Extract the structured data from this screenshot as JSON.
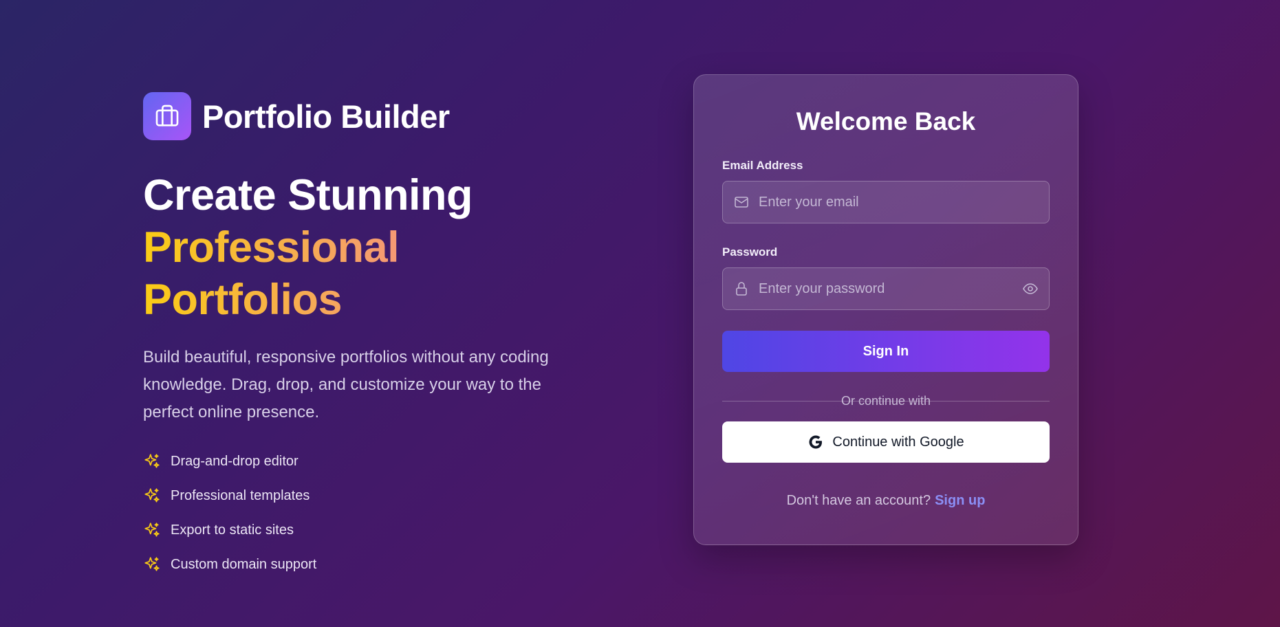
{
  "brand": {
    "title": "Portfolio Builder",
    "icon": "briefcase-icon"
  },
  "hero": {
    "line1": "Create Stunning",
    "line2": "Professional Portfolios",
    "description": "Build beautiful, responsive portfolios without any coding knowledge. Drag, drop, and customize your way to the perfect online presence."
  },
  "features": [
    {
      "label": "Drag-and-drop editor",
      "icon": "sparkles-icon"
    },
    {
      "label": "Professional templates",
      "icon": "sparkles-icon"
    },
    {
      "label": "Export to static sites",
      "icon": "sparkles-icon"
    },
    {
      "label": "Custom domain support",
      "icon": "sparkles-icon"
    }
  ],
  "login": {
    "title": "Welcome Back",
    "email_label": "Email Address",
    "email_placeholder": "Enter your email",
    "email_value": "",
    "password_label": "Password",
    "password_placeholder": "Enter your password",
    "password_value": "",
    "signin_label": "Sign In",
    "divider_text": "Or continue with",
    "google_label": "Continue with Google",
    "signup_prompt": "Don't have an account?",
    "signup_link": "Sign up"
  },
  "colors": {
    "accent_start": "#4f46e5",
    "accent_end": "#9333ea",
    "sparkle": "#facc15",
    "link": "#8b8ff5"
  }
}
